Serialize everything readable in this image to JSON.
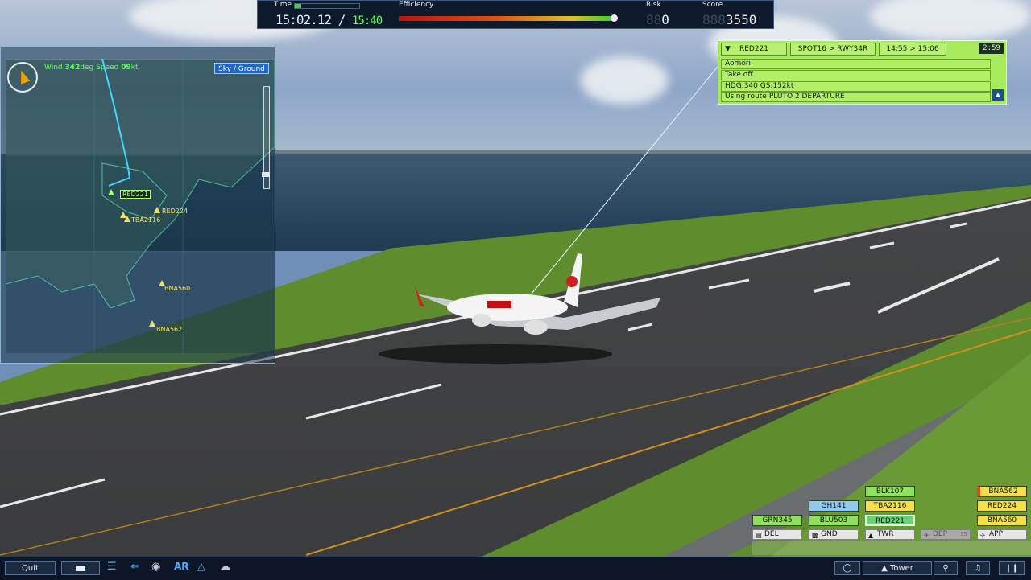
{
  "top_bar": {
    "time_label": "Time",
    "time_value": "15:02.12",
    "time_separator": "/",
    "time_target": "15:40",
    "efficiency_label": "Efficiency",
    "efficiency_level": 0.99,
    "risk_label": "Risk",
    "risk_value": "0",
    "score_label": "Score",
    "score_value": "3550"
  },
  "info_panel": {
    "callsign": "RED221",
    "route": "SPOT16 > RWY34R",
    "times": "14:55 > 15:06",
    "countdown": "2:59",
    "destination": "Aomori",
    "status": "Take off.",
    "heading_speed": "HDG:340 GS:152kt",
    "route_note": "Using route:PLUTO 2 DEPARTURE",
    "scroll_icon": "up-arrow-icon"
  },
  "radar": {
    "wind_label": "Wind",
    "wind_dir": "342",
    "wind_unit": "deg",
    "speed_label": "Speed",
    "speed_value": "09",
    "speed_unit": "kt",
    "view_toggle": "Sky / Ground",
    "aircraft": [
      {
        "callsign": "RED221",
        "selected": true
      },
      {
        "callsign": "RED224",
        "selected": false
      },
      {
        "callsign": "TBA2116",
        "selected": false
      },
      {
        "callsign": "BNA560",
        "selected": false
      },
      {
        "callsign": "BNA562",
        "selected": false
      }
    ]
  },
  "strips": {
    "tabs": [
      {
        "label": "DEL",
        "icon": "document-icon",
        "enabled": true
      },
      {
        "label": "GND",
        "icon": "car-icon",
        "enabled": true
      },
      {
        "label": "TWR",
        "icon": "tower-icon",
        "enabled": true
      },
      {
        "label": "DEP",
        "icon": "departure-icon",
        "enabled": false,
        "count": "35"
      },
      {
        "label": "APP",
        "icon": "arrival-icon",
        "enabled": true
      }
    ],
    "del": [
      "GRN345"
    ],
    "gnd": [
      "GH141",
      "BLU503"
    ],
    "twr": [
      "BLK107",
      "TBA2116",
      "RED221"
    ],
    "app": [
      "BNA562",
      "RED224",
      "BNA560"
    ]
  },
  "bottom_bar": {
    "quit_label": "Quit",
    "ar_label": "AR",
    "tower_label": "Tower",
    "icons": [
      "window-icon",
      "list-icon",
      "runway-icon",
      "chat-icon",
      "radar-icon",
      "weather-icon",
      "binoculars-icon",
      "search-icon",
      "music-icon",
      "pause-icon"
    ]
  },
  "colors": {
    "strip_green": "#8fe05a",
    "strip_yellow": "#f5e04a",
    "strip_blue": "#8fc8f0",
    "panel_green": "#a7ea5a",
    "accent_green": "#5cff5c",
    "accent_blue": "#4fb0ff"
  }
}
